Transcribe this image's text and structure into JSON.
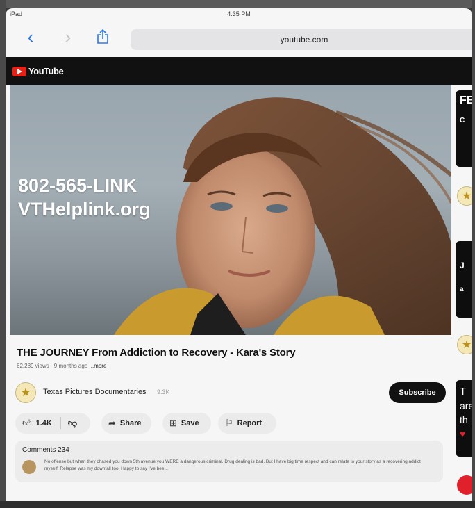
{
  "status_bar": {
    "device": "iPad",
    "time": "4:35 PM"
  },
  "browser": {
    "url": "youtube.com"
  },
  "youtube": {
    "logo_text": "YouTube"
  },
  "video": {
    "overlay_phone": "802-565-LINK",
    "overlay_url": "VTHelplink.org",
    "title": "THE JOURNEY From Addiction to Recovery - Kara's Story",
    "meta": "62,289 views · 9 months ago",
    "more_label": "...more"
  },
  "channel": {
    "name": "Texas Pictures Documentaries",
    "subscribers": "9.3K",
    "subscribe_label": "Subscribe"
  },
  "actions": {
    "likes": "1.4K",
    "share_label": "Share",
    "save_label": "Save",
    "report_label": "Report"
  },
  "comments": {
    "header": "Comments 234",
    "top_comment": "No offense but when they chased you down 5th avenue you WERE a dangerous criminal. Drug dealing is bad. But I have big time respect and can relate to your story as a recovering addict myself. Relapse was my downfall too. Happy to say I've bee..."
  },
  "sidebar": {
    "thumb1_top": "FE",
    "thumb1_bottom": "C",
    "thumb2_top": "J",
    "thumb2_bottom": "a",
    "thumb3_lines": [
      "T",
      "are",
      "th"
    ]
  },
  "colors": {
    "accent_blue": "#2c7ae8",
    "youtube_red": "#e62117",
    "header_black": "#111111"
  }
}
